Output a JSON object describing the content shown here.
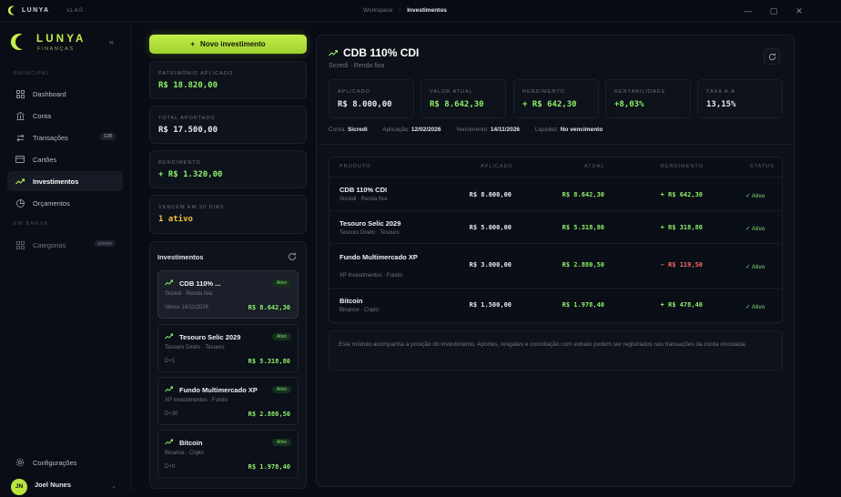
{
  "titlebar": {
    "app": "LUNYA",
    "version": "v1.4.0",
    "crumb_root": "Workspace",
    "crumb_sep": "/",
    "crumb_current": "Investimentos",
    "controls": [
      "minimize-icon",
      "maximize-icon",
      "close-icon"
    ]
  },
  "sidebar": {
    "brand_name": "LUNYA",
    "brand_sub": "FINANÇAS",
    "collapse": "«",
    "section_main": "PRINCIPAL",
    "section_soon": "EM BREVE",
    "items": [
      {
        "label": "Dashboard",
        "icon": "grid-icon"
      },
      {
        "label": "Conta",
        "icon": "bank-icon"
      },
      {
        "label": "Transações",
        "icon": "arrows-icon",
        "badge": "128"
      },
      {
        "label": "Cartões",
        "icon": "card-icon"
      },
      {
        "label": "Investimentos",
        "icon": "trend-icon",
        "active": true
      },
      {
        "label": "Orçamentos",
        "icon": "pie-icon"
      }
    ],
    "soon_items": [
      {
        "label": "Categorias",
        "icon": "grid-icon",
        "badge": "SOON"
      }
    ],
    "settings_label": "Configurações",
    "user": {
      "initials": "JN",
      "name": "Joel Nunes",
      "caret": "⌄"
    }
  },
  "new_button": {
    "icon": "+",
    "label": "Novo investimento"
  },
  "stats": [
    {
      "label": "PATRIMÔNIO APLICADO",
      "value": "R$ 18.820,00",
      "tone": "green"
    },
    {
      "label": "TOTAL APORTADO",
      "value": "R$ 17.500,00",
      "tone": "white"
    },
    {
      "label": "RENDIMENTO",
      "value": "+ R$ 1.320,00",
      "tone": "green"
    },
    {
      "label": "VENCEM EM 30 DIAS",
      "value": "1 ativo",
      "tone": "yellow"
    }
  ],
  "investments_panel": {
    "title": "Investimentos",
    "cards": [
      {
        "name": "CDB 110% ...",
        "sub": "Sicredi · Renda fixa",
        "meta": "Vence 14/11/2026",
        "value": "R$ 8.642,30",
        "status": "Ativo",
        "active": true
      },
      {
        "name": "Tesouro Selic 2029",
        "sub": "Tesouro Direto · Tesouro",
        "meta": "D+1",
        "value": "R$ 5.318,80",
        "status": "Ativo"
      },
      {
        "name": "Fundo Multimercado XP",
        "sub": "XP Investimentos · Fundo",
        "meta": "D+30",
        "value": "R$ 2.880,50",
        "status": "Ativo"
      },
      {
        "name": "Bitcoin",
        "sub": "Binance · Cripto",
        "meta": "D+0",
        "value": "R$ 1.978,40",
        "status": "Ativo"
      }
    ]
  },
  "detail": {
    "title": "CDB 110% CDI",
    "subtitle": "Sicredi · Renda fixa",
    "kpis": [
      {
        "label": "APLICADO",
        "value": "R$ 8.000,00",
        "tone": "white"
      },
      {
        "label": "VALOR ATUAL",
        "value": "R$ 8.642,30",
        "tone": "green"
      },
      {
        "label": "RENDIMENTO",
        "value": "+ R$ 642,30",
        "tone": "green"
      },
      {
        "label": "RENTABILIDADE",
        "value": "+8,03%",
        "tone": "green"
      },
      {
        "label": "TAXA A.A",
        "value": "13,15%",
        "tone": "white"
      }
    ],
    "info": {
      "conta_label": "Conta:",
      "conta_value": "Sicredi",
      "aplicacao_label": "Aplicação:",
      "aplicacao_value": "12/02/2026",
      "vencimento_label": "Vencimento:",
      "vencimento_value": "14/11/2026",
      "liquidez_label": "Liquidez:",
      "liquidez_value": "No vencimento"
    },
    "table": {
      "headers": [
        "PRODUTO",
        "APLICADO",
        "ATUAL",
        "RENDIMENTO",
        "STATUS"
      ],
      "rows": [
        {
          "name": "CDB 110% CDI",
          "sub": "Sicredi · Renda fixa",
          "aplicado": "R$ 8.000,00",
          "atual": "R$ 8.642,30",
          "rend": "+ R$ 642,30",
          "rend_tone": "green",
          "status": "✓ Ativo"
        },
        {
          "name": "Tesouro Selic 2029",
          "sub": "Tesouro Direto · Tesouro",
          "aplicado": "R$ 5.000,00",
          "atual": "R$ 5.318,80",
          "rend": "+ R$ 318,80",
          "rend_tone": "green",
          "status": "✓ Ativo"
        },
        {
          "name": "Fundo Multimercado XP",
          "sub": "XP Investimentos · Fundo",
          "aplicado": "R$ 3.000,00",
          "atual": "R$ 2.880,50",
          "rend": "− R$ 119,50",
          "rend_tone": "red",
          "status": "✓ Ativo"
        },
        {
          "name": "Bitcoin",
          "sub": "Binance · Cripto",
          "aplicado": "R$ 1.500,00",
          "atual": "R$ 1.978,40",
          "rend": "+ R$ 478,40",
          "rend_tone": "green",
          "status": "✓ Ativo"
        }
      ]
    },
    "note": "Este módulo acompanha a posição do investimento. Aportes, resgates e conciliação com extrato podem ser registrados nas transações da conta vinculada."
  },
  "colors": {
    "accent": "#c3ef4a",
    "positive": "#8ef06a",
    "negative": "#ff6b6b",
    "warning": "#f2c23a",
    "background": "#090c14"
  }
}
